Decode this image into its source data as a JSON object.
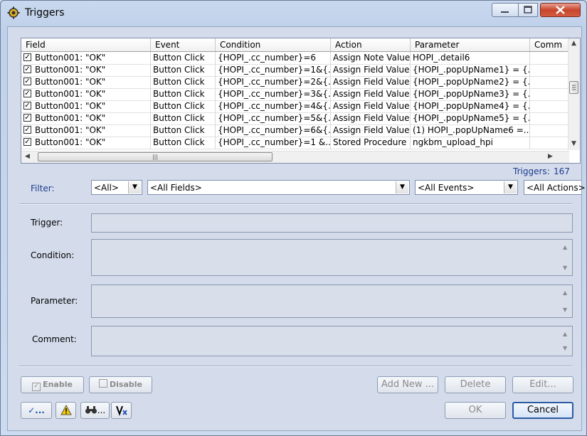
{
  "window": {
    "title": "Triggers"
  },
  "grid": {
    "columns": [
      "Field",
      "Event",
      "Condition",
      "Action",
      "Parameter",
      "Comm"
    ],
    "rows": [
      {
        "checked": true,
        "field": "Button001: \"OK\"",
        "event": "Button Click",
        "condition": "{HOPI_.cc_number}=6",
        "action": "Assign Note Value",
        "parameter": "HOPI_.detail6",
        "comment": ""
      },
      {
        "checked": true,
        "field": "Button001: \"OK\"",
        "event": "Button Click",
        "condition": "{HOPI_.cc_number}=1&{...",
        "action": "Assign Field Value",
        "parameter": "{HOPI_.popUpName1} = {...",
        "comment": ""
      },
      {
        "checked": true,
        "field": "Button001: \"OK\"",
        "event": "Button Click",
        "condition": "{HOPI_.cc_number}=2&{...",
        "action": "Assign Field Value",
        "parameter": "{HOPI_.popUpName2} = {...",
        "comment": ""
      },
      {
        "checked": true,
        "field": "Button001: \"OK\"",
        "event": "Button Click",
        "condition": "{HOPI_.cc_number}=3&{...",
        "action": "Assign Field Value",
        "parameter": "{HOPI_.popUpName3} = {...",
        "comment": ""
      },
      {
        "checked": true,
        "field": "Button001: \"OK\"",
        "event": "Button Click",
        "condition": "{HOPI_.cc_number}=4&{...",
        "action": "Assign Field Value",
        "parameter": "{HOPI_.popUpName4} = {...",
        "comment": ""
      },
      {
        "checked": true,
        "field": "Button001: \"OK\"",
        "event": "Button Click",
        "condition": "{HOPI_.cc_number}=5&{...",
        "action": "Assign Field Value",
        "parameter": "{HOPI_.popUpName5} = {...",
        "comment": ""
      },
      {
        "checked": true,
        "field": "Button001: \"OK\"",
        "event": "Button Click",
        "condition": "{HOPI_.cc_number}=6&{...",
        "action": "Assign Field Value",
        "parameter": "(1) HOPI_.popUpName6 =...",
        "comment": ""
      },
      {
        "checked": true,
        "field": "Button001: \"OK\"",
        "event": "Button Click",
        "condition": "{HOPI_.cc_number}=1 &...",
        "action": "Stored Procedure",
        "parameter": "ngkbm_upload_hpi",
        "comment": ""
      }
    ]
  },
  "count": {
    "label": "Triggers:",
    "value": "167"
  },
  "filter": {
    "label": "Filter:",
    "type": "<All>",
    "fields": "<All Fields>",
    "events": "<All Events>",
    "actions": "<All Actions>"
  },
  "details": {
    "trigger_label": "Trigger:",
    "condition_label": "Condition:",
    "parameter_label": "Parameter:",
    "comment_label": "Comment:"
  },
  "buttons": {
    "enable": "Enable",
    "disable": "Disable",
    "add_new": "Add New ...",
    "delete": "Delete",
    "edit": "Edit...",
    "ok": "OK",
    "cancel": "Cancel",
    "tool1": "✓...",
    "tool3": "..."
  },
  "icons": [
    "app-gear-icon",
    "minimize-icon",
    "maximize-icon",
    "close-icon",
    "check-icon",
    "warning-icon",
    "binoculars-icon",
    "variable-icon"
  ]
}
